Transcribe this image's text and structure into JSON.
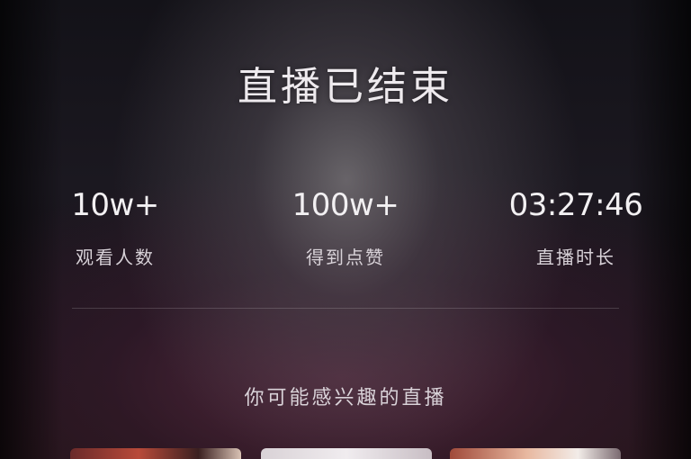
{
  "live_end": {
    "title": "直播已结束",
    "stats": [
      {
        "value": "10w+",
        "label": "观看人数"
      },
      {
        "value": "100w+",
        "label": "得到点赞"
      },
      {
        "value": "03:27:46",
        "label": "直播时长"
      }
    ],
    "recommend_heading": "你可能感兴趣的直播"
  },
  "colors": {
    "text_primary": "#eeeaee",
    "text_secondary": "#d8d2d8",
    "background_dark": "#131218"
  }
}
